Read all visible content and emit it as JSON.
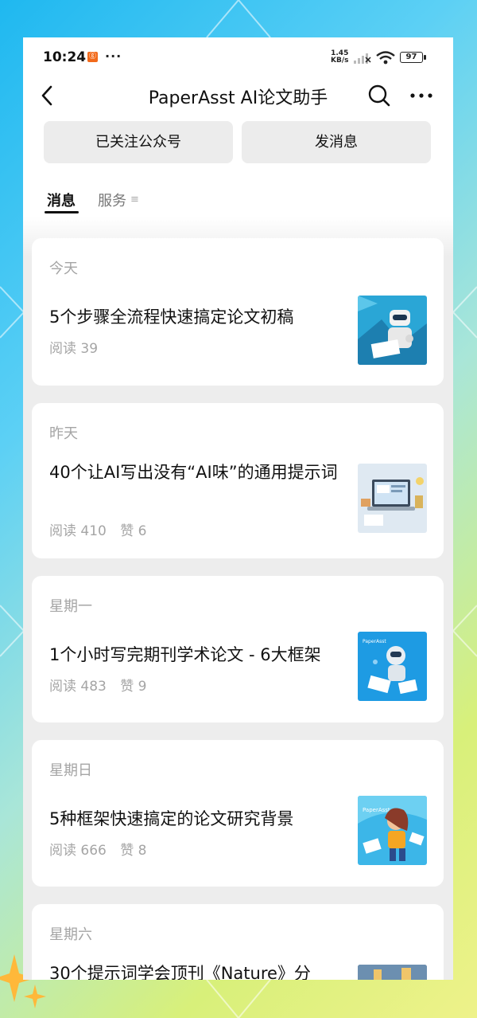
{
  "status": {
    "time": "10:24",
    "app_badge": "ⓖ",
    "more": "···",
    "net_speed_value": "1.45",
    "net_speed_unit": "KB/s",
    "battery": "97"
  },
  "nav": {
    "title": "PaperAsst AI论文助手",
    "back_icon": "chevron-left-icon",
    "search_icon": "search-icon",
    "more_icon": "more-horizontal-icon"
  },
  "actions": {
    "followed": "已关注公众号",
    "send_message": "发消息"
  },
  "tabs": {
    "messages": "消息",
    "services": "服务",
    "services_icon": "≡"
  },
  "cards": [
    {
      "date": "今天",
      "title": "5个步骤全流程快速搞定论文初稿",
      "reads": "阅读 39",
      "likes": ""
    },
    {
      "date": "昨天",
      "title": "40个让AI写出没有“AI味”的通用提示词",
      "reads": "阅读 410",
      "likes": "赞 6"
    },
    {
      "date": "星期一",
      "title": "1个小时写完期刊学术论文 - 6大框架",
      "reads": "阅读 483",
      "likes": "赞 9"
    },
    {
      "date": "星期日",
      "title": "5种框架快速搞定的论文研究背景",
      "reads": "阅读 666",
      "likes": "赞 8"
    },
    {
      "date": "星期六",
      "title": "30个提示词学会顶刊《Nature》分",
      "reads": "",
      "likes": ""
    }
  ],
  "thumb_labels": {
    "card3": "PaperAsst",
    "card4": "PaperAsst"
  },
  "colors": {
    "accent": "#111111",
    "muted": "#a5a5a5",
    "card_bg": "#ffffff",
    "page_bg": "#ededed"
  }
}
